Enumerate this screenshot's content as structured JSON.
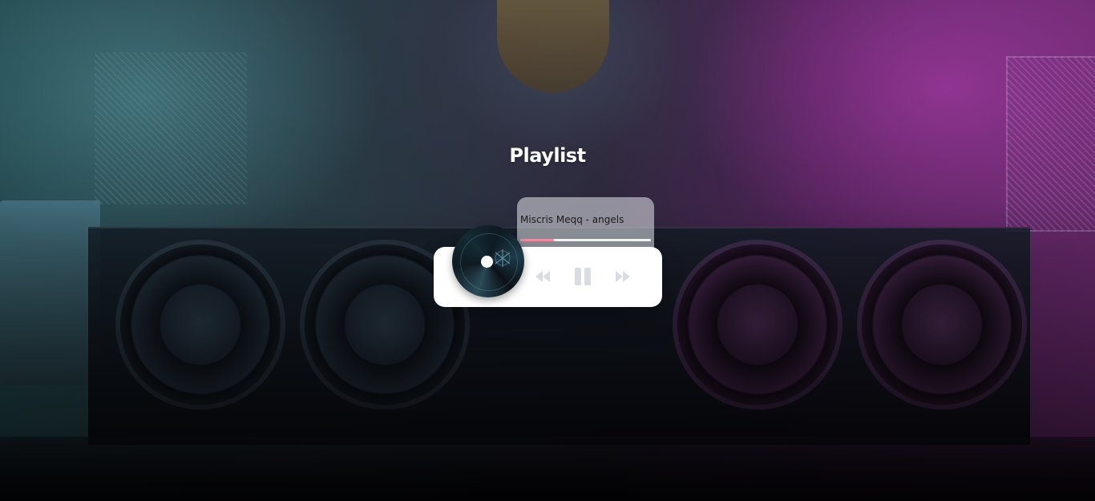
{
  "page": {
    "title": "Playlist"
  },
  "player": {
    "track_title": "Miscris Meqq - angels",
    "progress": 0.26,
    "state": "playing",
    "controls": {
      "previous_icon": "rewind-icon",
      "play_pause_icon": "pause-icon",
      "next_icon": "fast-forward-icon"
    },
    "colors": {
      "progress_fill": "#f08aa0",
      "progress_track": "#f3f3f3",
      "icon": "#d9dde3",
      "card": "#ffffff"
    }
  }
}
